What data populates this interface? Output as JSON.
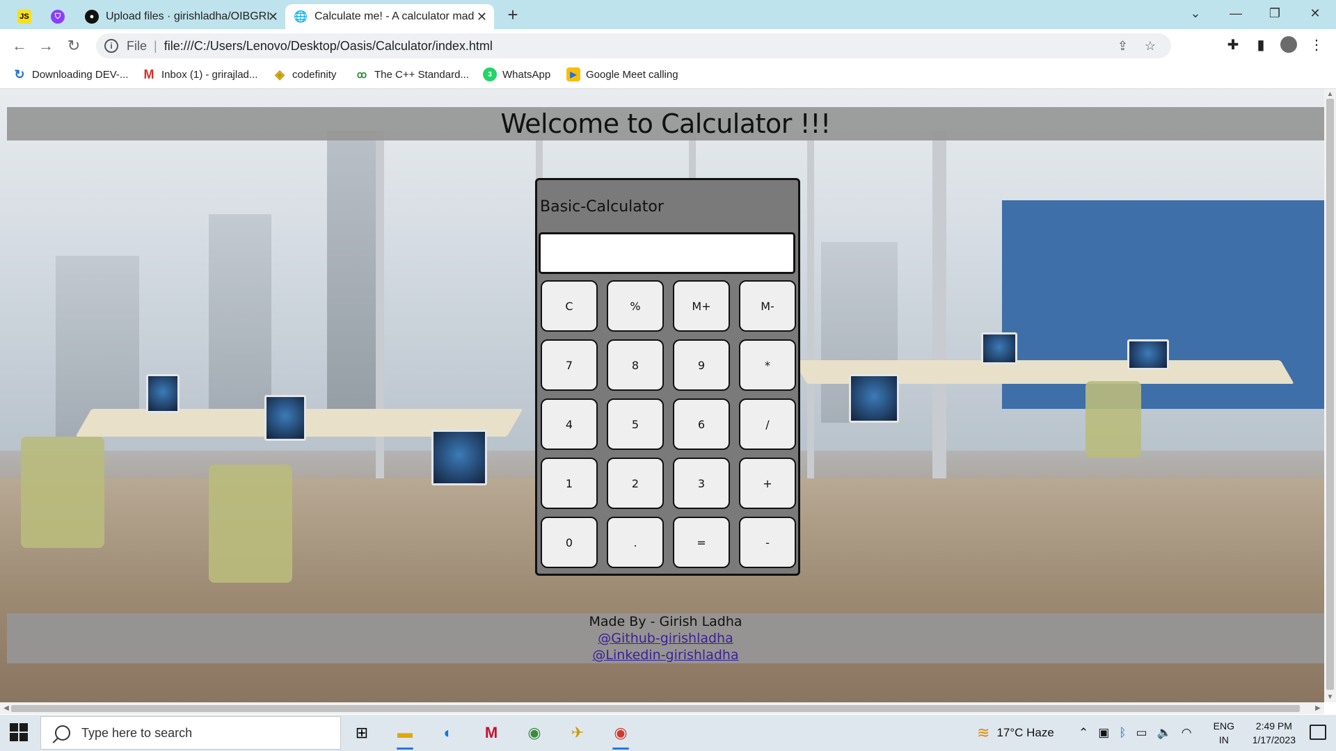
{
  "browser": {
    "tabs": [
      {
        "favicon": "js-icon",
        "title": "",
        "pinned": true
      },
      {
        "favicon": "grammarly-icon",
        "title": "",
        "pinned": true
      },
      {
        "favicon": "github-icon",
        "title": "Upload files · girishladha/OIBGRI",
        "pinned": false
      },
      {
        "favicon": "globe-icon",
        "title": "Calculate me! - A calculator mad",
        "pinned": false,
        "active": true
      }
    ],
    "address": {
      "scheme_label": "File",
      "url": "file:///C:/Users/Lenovo/Desktop/Oasis/Calculator/index.html"
    },
    "bookmarks": [
      {
        "icon": "dev-icon",
        "label": "Downloading DEV-..."
      },
      {
        "icon": "gmail-icon",
        "label": "Inbox (1) - grirajlad..."
      },
      {
        "icon": "codefinity-icon",
        "label": "codefinity"
      },
      {
        "icon": "cpp-icon",
        "label": "The C++ Standard..."
      },
      {
        "icon": "whatsapp-icon",
        "label": "WhatsApp"
      },
      {
        "icon": "meet-icon",
        "label": "Google Meet calling"
      }
    ]
  },
  "page": {
    "heading": "Welcome to Calculator !!!",
    "calculator": {
      "title": "Basic-Calculator",
      "display_value": "",
      "keys": [
        [
          "C",
          "%",
          "M+",
          "M-"
        ],
        [
          "7",
          "8",
          "9",
          "*"
        ],
        [
          "4",
          "5",
          "6",
          "/"
        ],
        [
          "1",
          "2",
          "3",
          "+"
        ],
        [
          "0",
          ".",
          "=",
          "-"
        ]
      ]
    },
    "footer": {
      "made_by": "Made By - Girish Ladha",
      "github_link": "@Github-girishladha",
      "linkedin_link": "@Linkedin-girishladha"
    }
  },
  "taskbar": {
    "search_placeholder": "Type here to search",
    "weather": "17°C  Haze",
    "language": "ENG",
    "region": "IN",
    "time": "2:49 PM",
    "date": "1/17/2023"
  },
  "colors": {
    "tab_strip": "#bfe3ec",
    "band_gray": "#969696",
    "calculator_body": "#7a7a7a",
    "link": "#3b1f9a"
  }
}
